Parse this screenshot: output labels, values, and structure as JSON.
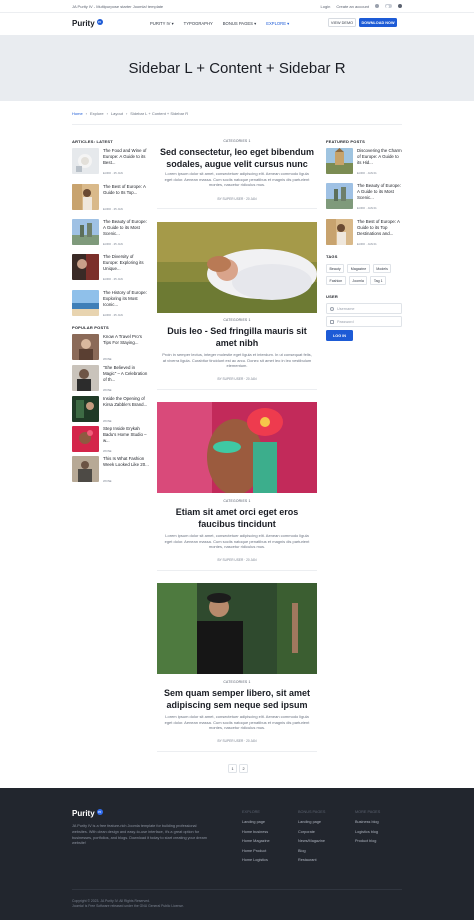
{
  "topbar": {
    "tagline": "JA Purity IV - Multipurpose starter Joomla! template",
    "login_label": "Login",
    "create_account_label": "Create an account"
  },
  "header": {
    "logo_text": "Purity",
    "logo_badge": "IV",
    "nav": [
      {
        "label": "PURITY IV ▾"
      },
      {
        "label": "TYPOGRAPHY"
      },
      {
        "label": "BONUS PAGES ▾"
      },
      {
        "label": "EXPLORE ▾"
      }
    ],
    "view_demo_label": "VIEW DEMO",
    "download_label": "DOWNLOAD NOW"
  },
  "hero": {
    "title": "Sidebar L + Content + Sidebar R"
  },
  "breadcrumb": [
    "Home",
    "Explore",
    "Layout",
    "Sidebar L + Content + Sidebar R"
  ],
  "left": {
    "latest_heading": "ARTICLES: LATEST",
    "latest": [
      {
        "title": "The Food and Wine of Europe: A Guide to its Best...",
        "meta": "EURO  ·  25 JAN"
      },
      {
        "title": "The Best of Europe: A Guide to Its Top...",
        "meta": "EURO  ·  25 JAN"
      },
      {
        "title": "The Beauty of Europe: A Guide to its Most Scenic...",
        "meta": "EURO  ·  25 JAN"
      },
      {
        "title": "The Diversity of Europe: Exploring its Unique...",
        "meta": "EURO  ·  25 JAN"
      },
      {
        "title": "The History of Europe: Exploring its Most Iconic...",
        "meta": "EURO  ·  25 JAN"
      }
    ],
    "popular_heading": "POPULAR POSTS",
    "popular": [
      {
        "title": "Know A Travel Pro's Tips For Staying...",
        "meta": "WOSE"
      },
      {
        "title": "\"She Believed in Magic\" – A Celebration of th...",
        "meta": "WOSE"
      },
      {
        "title": "Inside the Opening of Kirsa Zabble's Brand...",
        "meta": "WOSE"
      },
      {
        "title": "Step Inside Erykah Badu's Home Studio – w...",
        "meta": "WOSE"
      },
      {
        "title": "This Is What Fashion Week Looked Like 20...",
        "meta": "WOSE"
      }
    ]
  },
  "articles": [
    {
      "category": "CATEGORIES 1",
      "title": "Sed consectetur, leo eget bibendum sodales, augue velit cursus nunc",
      "body": "Lorem ipsum dolor sit amet, consectetuer adipiscing elit. Aenean commodo ligula eget dolor. Aenean massa. Cum sociis natoque penatibus et magnis dis parturient montes, nascetur ridiculus mus.",
      "meta": "BY SUPER USER  ·  20 JAN"
    },
    {
      "category": "CATEGORIES 1",
      "title": "Duis leo - Sed fringilla mauris sit amet nibh",
      "body": "Proin in semper lectus, integer molestie eget ligula et interdum. In ut consequat felis, at viverra ligula. Curabitur tincidunt est ac arcu. Donec sit amet leo in leo vestibulum elementum.",
      "meta": "BY SUPER USER  ·  20 JAN"
    },
    {
      "category": "CATEGORIES 1",
      "title": "Etiam sit amet orci eget eros faucibus tincidunt",
      "body": "Lorem ipsum dolor sit amet, consectetuer adipiscing elit. Aenean commodo ligula eget dolor. Aenean massa. Cum sociis natoque penatibus et magnis dis parturient montes, nascetur ridiculus mus.",
      "meta": "BY SUPER USER  ·  20 JAN"
    },
    {
      "category": "CATEGORIES 1",
      "title": "Sem quam semper libero, sit amet adipiscing sem neque sed ipsum",
      "body": "Lorem ipsum dolor sit amet, consectetuer adipiscing elit. Aenean commodo ligula eget dolor. Aenean massa. Cum sociis natoque penatibus et magnis dis parturient montes, nascetur ridiculus mus.",
      "meta": "BY SUPER USER  ·  20 JAN"
    }
  ],
  "pagination": [
    "1",
    "2"
  ],
  "right": {
    "featured_heading": "FEATURED POSTS",
    "featured": [
      {
        "title": "Discovering the Charm of Europe: A Guide to its Hid...",
        "meta": "EURO  ·  JAN 01"
      },
      {
        "title": "The Beauty of Europe: A Guide to its Most Scenic...",
        "meta": "EURO  ·  JAN 01"
      },
      {
        "title": "The Best of Europe: A Guide to its Top Destinations and...",
        "meta": "EURO  ·  JAN 01"
      }
    ],
    "tags_heading": "TAGS",
    "tags": [
      "Beauty",
      "Magazine",
      "Models",
      "Fashion",
      "Joomla",
      "Tag 1"
    ],
    "user_heading": "USER",
    "username_placeholder": "Username",
    "password_placeholder": "Password",
    "login_button": "LOG IN"
  },
  "footer": {
    "logo_text": "Purity",
    "logo_badge": "IV",
    "description": "JA Purity IV is a free feature-rich Joomla template for building professional websites. With clean design and easy-to-use interface, it's a great option for businesses, portfolios, and blogs. Download it today to start creating your dream website!",
    "columns": [
      {
        "heading": "EXPLORE",
        "links": [
          "Landing page",
          "Home business",
          "Home Magazine",
          "Home Product",
          "Home Logistics"
        ]
      },
      {
        "heading": "BONUS PAGES",
        "links": [
          "Landing page",
          "Corporate",
          "News/Magazine",
          "Blog",
          "Restaurant"
        ]
      },
      {
        "heading": "MORE PAGES",
        "links": [
          "Business blog",
          "Logistics blog",
          "Product blog"
        ]
      }
    ],
    "copyright_1": "Copyright © 2023. JA Purity IV. All Rights Reserved.",
    "copyright_2": "Joomla! is Free Software released under the GNU General Public License."
  },
  "colors": {
    "accent": "#1d5bd6",
    "hero_bg": "#e9ecf0",
    "footer_bg": "#22262e"
  }
}
